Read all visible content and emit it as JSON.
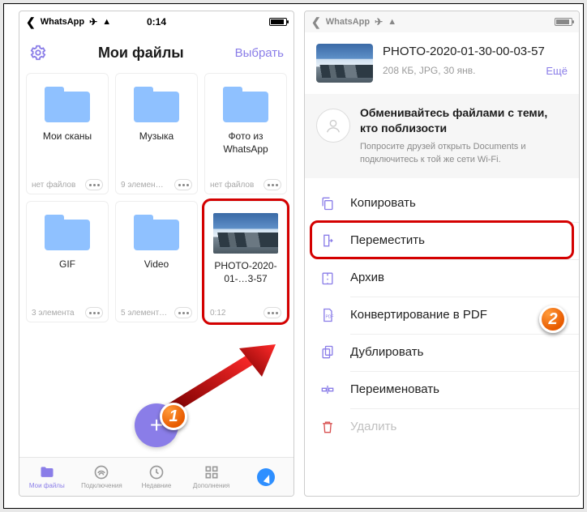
{
  "accent": "#8a7de8",
  "left": {
    "statusbar": {
      "back": "WhatsApp",
      "time": "0:14"
    },
    "title": "Мои файлы",
    "select": "Выбрать",
    "cards": [
      {
        "name": "Мои сканы",
        "footer": "нет файлов",
        "type": "folder"
      },
      {
        "name": "Музыка",
        "footer": "9 элемен…",
        "type": "folder"
      },
      {
        "name": "Фото из WhatsApp",
        "footer": "нет файлов",
        "type": "folder"
      },
      {
        "name": "GIF",
        "footer": "3 элемента",
        "type": "folder"
      },
      {
        "name": "Video",
        "footer": "5 элемент…",
        "type": "folder"
      },
      {
        "name": "PHOTO-2020-01-…3-57",
        "footer": "0:12",
        "type": "image"
      }
    ],
    "tabs": [
      {
        "label": "Мои файлы"
      },
      {
        "label": "Подключения"
      },
      {
        "label": "Недавние"
      },
      {
        "label": "Дополнения"
      },
      {
        "label": ""
      }
    ]
  },
  "right": {
    "statusbar": {
      "back": "WhatsApp"
    },
    "file": {
      "name": "PHOTO-2020-01-30-00-03-57",
      "meta": "208 КБ, JPG, 30 янв.",
      "more": "Ещё"
    },
    "share": {
      "title": "Обменивайтесь файлами с теми, кто поблизости",
      "body": "Попросите друзей открыть Documents и подключитесь к той же сети Wi-Fi."
    },
    "actions": [
      {
        "label": "Копировать",
        "icon": "copy"
      },
      {
        "label": "Переместить",
        "icon": "move",
        "highlight": true
      },
      {
        "label": "Архив",
        "icon": "archive"
      },
      {
        "label": "Конвертирование в PDF",
        "icon": "pdf"
      },
      {
        "label": "Дублировать",
        "icon": "duplicate"
      },
      {
        "label": "Переименовать",
        "icon": "rename"
      },
      {
        "label": "Удалить",
        "icon": "delete",
        "danger": true
      }
    ]
  },
  "badges": {
    "one": "1",
    "two": "2"
  }
}
